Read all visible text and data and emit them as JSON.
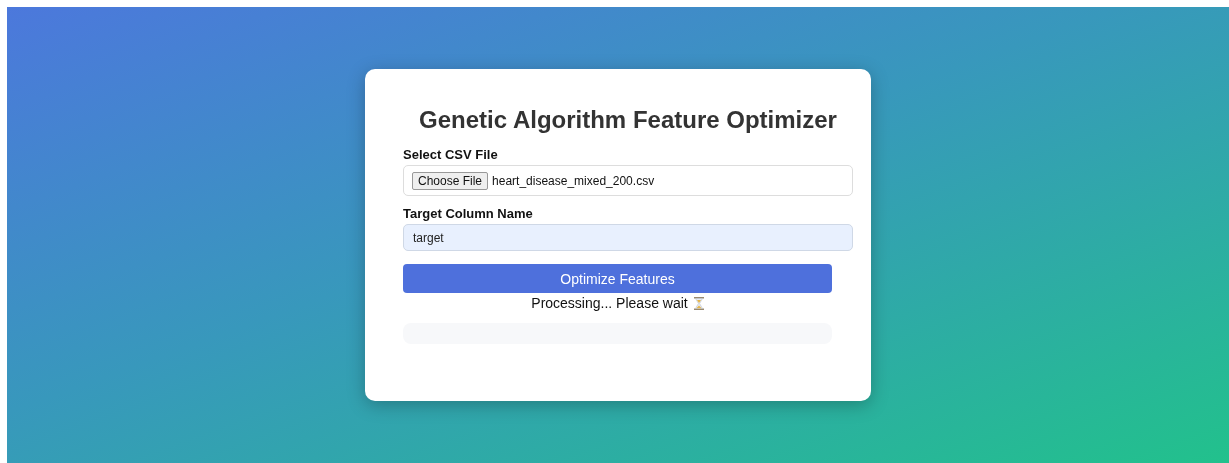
{
  "title": "Genetic Algorithm Feature Optimizer",
  "file_field": {
    "label": "Select CSV File",
    "button": "Choose File",
    "file_name": "heart_disease_mixed_200.csv"
  },
  "target_field": {
    "label": "Target Column Name",
    "value": "target"
  },
  "submit_button": "Optimize Features",
  "status": {
    "text": "Processing... Please wait",
    "busy": true
  }
}
